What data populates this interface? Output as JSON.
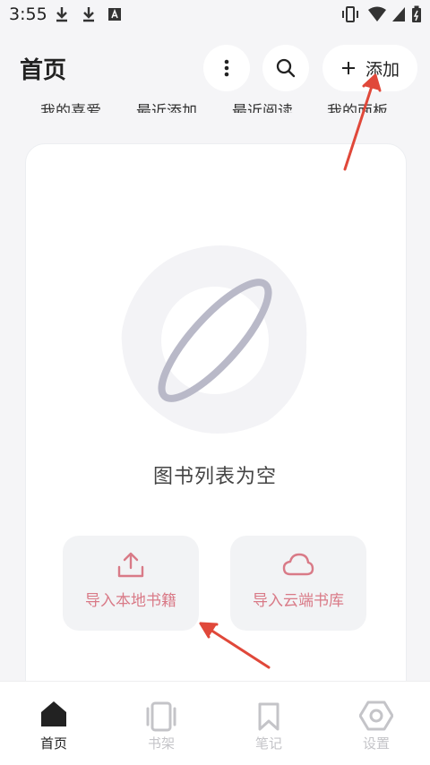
{
  "status_bar": {
    "time": "3:55",
    "icons": [
      "download-icon",
      "download-icon",
      "font-app-icon",
      "vibrate-icon",
      "wifi-icon",
      "signal-icon",
      "battery-icon"
    ]
  },
  "header": {
    "title": "首页",
    "more_icon": "more-vertical-icon",
    "search_icon": "search-icon",
    "add_label": "添加",
    "add_icon": "plus-icon"
  },
  "filters": [
    "我的喜爱",
    "最近添加",
    "最近阅读",
    "我的面板"
  ],
  "empty_state": {
    "message": "图书列表为空",
    "illustration": "planet-icon"
  },
  "import_buttons": [
    {
      "label": "导入本地书籍",
      "icon": "upload-icon"
    },
    {
      "label": "导入云端书库",
      "icon": "cloud-icon"
    }
  ],
  "bottom_nav": [
    {
      "label": "首页",
      "icon": "home-icon",
      "active": true
    },
    {
      "label": "书架",
      "icon": "bookshelf-icon",
      "active": false
    },
    {
      "label": "笔记",
      "icon": "bookmark-icon",
      "active": false
    },
    {
      "label": "设置",
      "icon": "settings-icon",
      "active": false
    }
  ],
  "colors": {
    "accent": "#d97a87",
    "arrow": "#e0483a",
    "active_nav": "#222222",
    "inactive_nav": "#c4c4c8"
  }
}
